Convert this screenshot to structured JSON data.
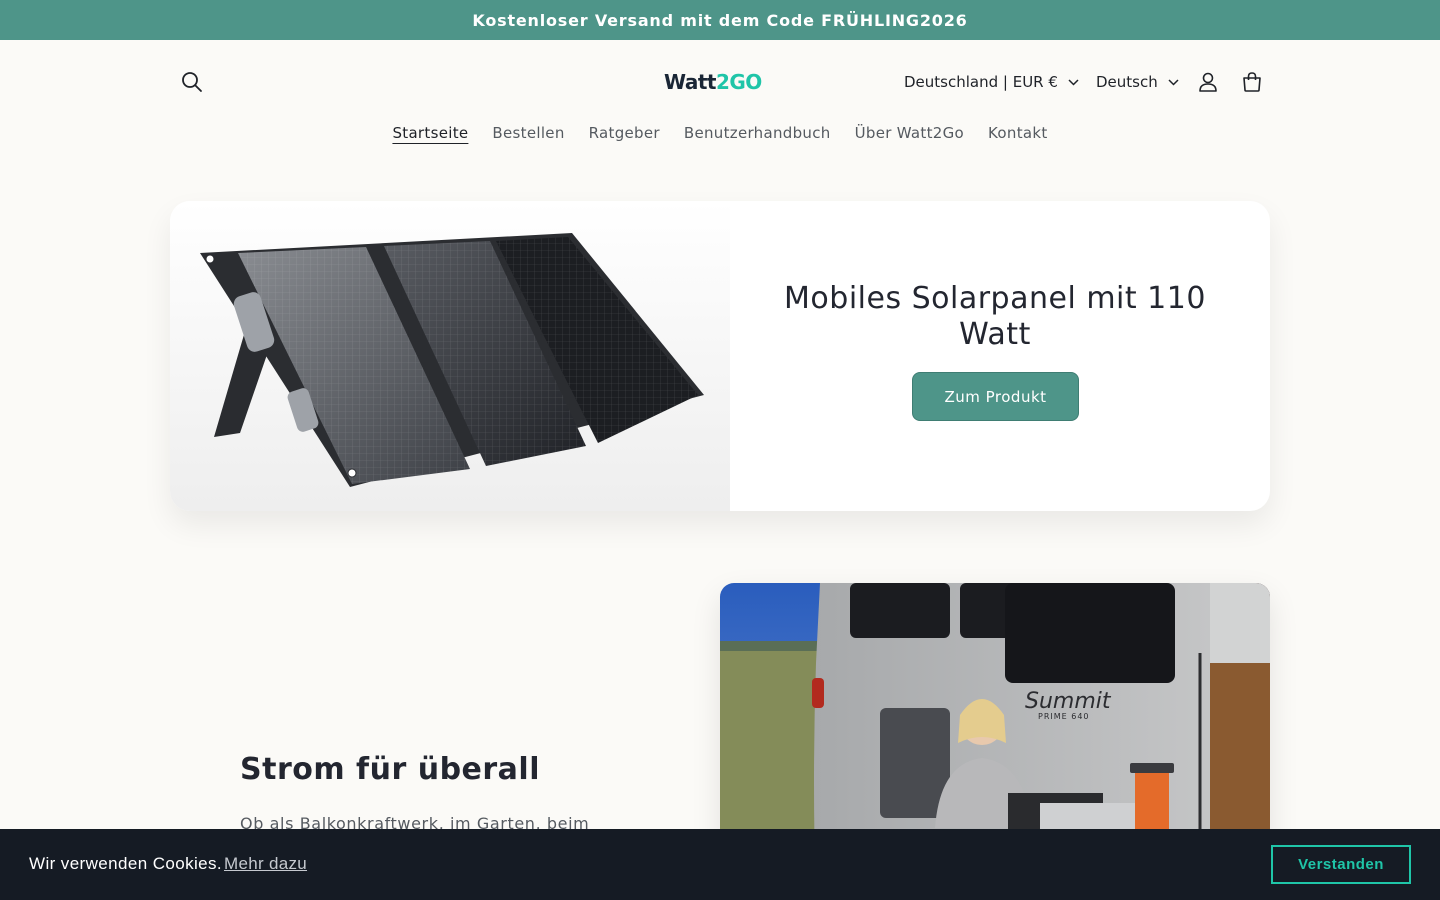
{
  "announcement": {
    "text": "Kostenloser Versand mit dem Code FRÜHLING2026"
  },
  "header": {
    "logo_part1": "Watt",
    "logo_part2": "2GO",
    "country_selector": "Deutschland | EUR €",
    "language_selector": "Deutsch"
  },
  "nav": {
    "items": [
      "Startseite",
      "Bestellen",
      "Ratgeber",
      "Benutzerhandbuch",
      "Über Watt2Go",
      "Kontakt"
    ]
  },
  "hero": {
    "title": "Mobiles Solarpanel mit 110 Watt",
    "button_label": "Zum Produkt"
  },
  "feature": {
    "title": "Strom für überall",
    "text": "Ob als Balkonkraftwerk, im Garten, beim",
    "image_brand_text": "Summit",
    "image_model_text": "PRIME 640"
  },
  "cookie": {
    "message": "Wir verwenden Cookies.",
    "link_label": "Mehr dazu",
    "accept_label": "Verstanden"
  },
  "colors": {
    "accent": "#4e9589",
    "brand_teal": "#1fc5a8",
    "logo_dark": "#1a2636",
    "cookie_bar": "#151b24",
    "page_bg": "#fbfaf7"
  },
  "icons": {
    "search": "search-icon",
    "account": "account-icon",
    "cart": "cart-icon",
    "chevron": "chevron-down-icon"
  }
}
